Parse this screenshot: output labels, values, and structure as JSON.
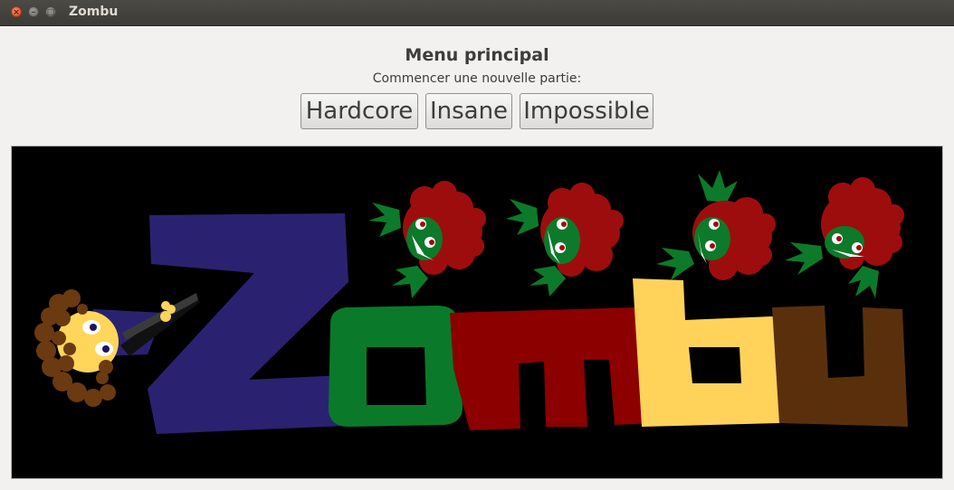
{
  "window": {
    "title": "Zombu",
    "controls": [
      "close-icon",
      "minimize-icon",
      "maximize-icon"
    ]
  },
  "menu": {
    "heading": "Menu principal",
    "subtitle": "Commencer une nouvelle partie:",
    "buttons": [
      {
        "label": "Hardcore"
      },
      {
        "label": "Insane"
      },
      {
        "label": "Impossible"
      }
    ]
  },
  "banner": {
    "logo_text": "Zombu",
    "colors": {
      "background": "#000000",
      "Z": "#2a2270",
      "o": "#0a7a2a",
      "m": "#8c0000",
      "b": "#ffd25a",
      "u": "#5a300c",
      "zombie_fur": "#9e0d0d",
      "zombie_skin": "#0c7a2a",
      "hero_face": "#ffd65a",
      "hero_hair": "#6b3a10"
    }
  }
}
